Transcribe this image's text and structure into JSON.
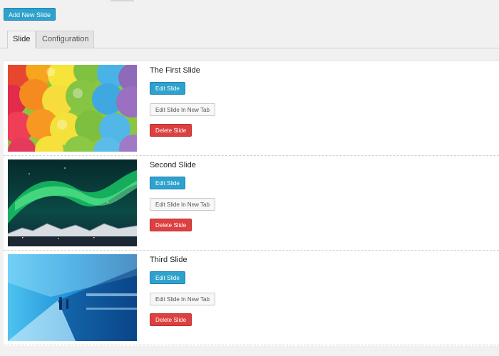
{
  "toolbar": {
    "add_new_slide_label": "Add New Slide"
  },
  "tabs": [
    {
      "label": "Slide",
      "active": true
    },
    {
      "label": "Configuration",
      "active": false
    }
  ],
  "slides": [
    {
      "title": "The First Slide",
      "image": "colorful-balloons",
      "edit_label": "Edit Slide",
      "edit_new_tab_label": "Edit Slide In New Tab",
      "delete_label": "Delete Slide"
    },
    {
      "title": "Second Slide",
      "image": "northern-lights",
      "edit_label": "Edit Slide",
      "edit_new_tab_label": "Edit Slide In New Tab",
      "delete_label": "Delete Slide"
    },
    {
      "title": "Third Slide",
      "image": "blue-train-station",
      "edit_label": "Edit Slide",
      "edit_new_tab_label": "Edit Slide In New Tab",
      "delete_label": "Delete Slide"
    }
  ],
  "colors": {
    "primary_button": "#2ea2cc",
    "delete_button": "#dd4040",
    "secondary_button": "#f7f7f7",
    "background": "#f1f1f1"
  }
}
